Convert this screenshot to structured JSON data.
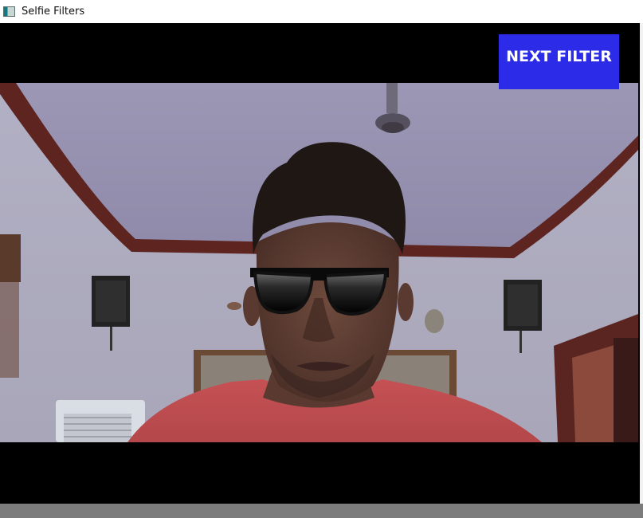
{
  "window": {
    "title": "Selfie Filters",
    "icon": "app-window-icon"
  },
  "overlay": {
    "next_filter_label": "NEXT FILTER",
    "button_color": "#2b2be8"
  },
  "scene": {
    "active_filter": "sunglasses-filter",
    "description_icons": [
      "ceiling-fan",
      "speaker-left",
      "speaker-right",
      "wall-clock",
      "air-cooler",
      "picture-frame"
    ]
  }
}
